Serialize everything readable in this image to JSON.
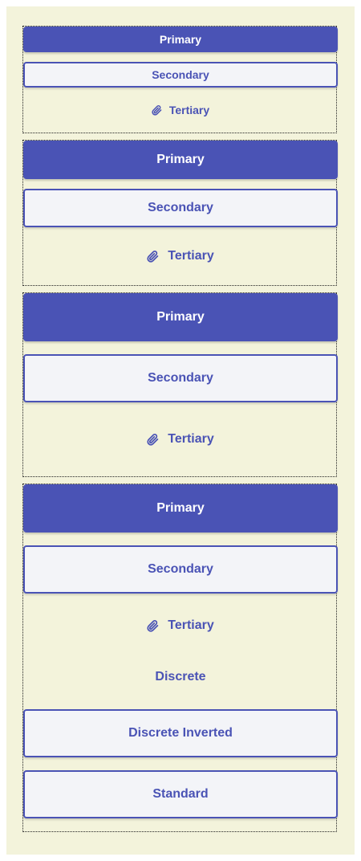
{
  "colors": {
    "page_background": "#f3f3db",
    "accent": "#4a53b5",
    "secondary_fill": "#f3f4f8",
    "primary_text": "#ffffff"
  },
  "groups": [
    {
      "size": "small",
      "primary_label": "Primary",
      "secondary_label": "Secondary",
      "tertiary_label": "Tertiary",
      "tertiary_icon": "paperclip-icon"
    },
    {
      "size": "medium",
      "primary_label": "Primary",
      "secondary_label": "Secondary",
      "tertiary_label": "Tertiary",
      "tertiary_icon": "paperclip-icon"
    },
    {
      "size": "large",
      "primary_label": "Primary",
      "secondary_label": "Secondary",
      "tertiary_label": "Tertiary",
      "tertiary_icon": "paperclip-icon"
    },
    {
      "size": "large",
      "primary_label": "Primary",
      "secondary_label": "Secondary",
      "tertiary_label": "Tertiary",
      "tertiary_icon": "paperclip-icon",
      "discrete_label": "Discrete",
      "discrete_inverted_label": "Discrete Inverted",
      "standard_label": "Standard"
    }
  ]
}
